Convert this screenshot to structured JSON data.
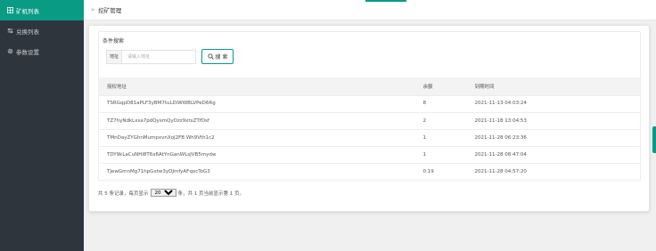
{
  "sidebar": {
    "items": [
      {
        "icon": "grid-icon",
        "label": "矿机列表",
        "active": true
      },
      {
        "icon": "sliders-icon",
        "label": "兑换列表",
        "active": false
      },
      {
        "icon": "gear-icon",
        "label": "参数设置",
        "active": false
      }
    ]
  },
  "topbar": {
    "arrow": "»",
    "title": "挖矿管理"
  },
  "search": {
    "legend": "条件搜索",
    "addr_label": "地址",
    "addr_placeholder": "请输入地址",
    "button_label": "搜 索"
  },
  "table": {
    "columns": [
      "授权地址",
      "余额",
      "到期时间"
    ],
    "rows": [
      [
        "TSRGqpD81aPLF3yBM7tuLDiWWBLVPeD6Rg",
        "8",
        "2021-11-13 04:03:24"
      ],
      [
        "TZ7hyNdkLxsa7pdQysmQyDzz9xtxZTfDsf",
        "2",
        "2021-11-18 13:04:53"
      ],
      [
        "TMnDayZYGhnMumpxvnXoJ2FB Wh9Vth1c2",
        "1",
        "2021-11-28 06:23:36"
      ],
      [
        "TDY9kLaCuNHl8T6x6AtYnGanWLsJVB5mydw",
        "1",
        "2021-11-28 08:47:04"
      ],
      [
        "TJewGmnMg71hpGxtw3yDJmfyAFqocToG3",
        "0.19",
        "2021-11-28 04:57:20"
      ]
    ]
  },
  "pager": {
    "prefix": "共 5 条记录，每页显示",
    "page_size": "20",
    "page_size_options": [
      "20"
    ],
    "suffix": "条，共 1 页当前显示第 1 页。"
  },
  "colors": {
    "accent": "#0a9b85",
    "sidebar_bg": "#2f353d"
  }
}
